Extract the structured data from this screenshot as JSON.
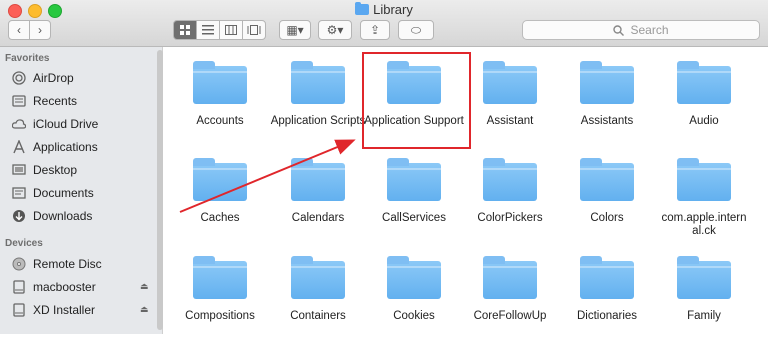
{
  "window": {
    "title": "Library"
  },
  "toolbar": {
    "back_label": "‹",
    "forward_label": "›",
    "arrange_label": "▦▾",
    "action_label": "⚙▾",
    "share_label": "⇪",
    "tag_label": "⬭",
    "search_placeholder": "Search"
  },
  "sidebar": {
    "favorites_heading": "Favorites",
    "devices_heading": "Devices",
    "favorites": [
      {
        "label": "AirDrop",
        "icon": "airdrop-icon"
      },
      {
        "label": "Recents",
        "icon": "recents-icon"
      },
      {
        "label": "iCloud Drive",
        "icon": "cloud-icon"
      },
      {
        "label": "Applications",
        "icon": "applications-icon"
      },
      {
        "label": "Desktop",
        "icon": "desktop-icon"
      },
      {
        "label": "Documents",
        "icon": "documents-icon"
      },
      {
        "label": "Downloads",
        "icon": "downloads-icon"
      }
    ],
    "devices": [
      {
        "label": "Remote Disc",
        "icon": "disc-icon"
      },
      {
        "label": "macbooster",
        "icon": "drive-icon"
      },
      {
        "label": "XD Installer",
        "icon": "drive-icon"
      }
    ]
  },
  "folders": [
    "Accounts",
    "Application Scripts",
    "Application Support",
    "Assistant",
    "Assistants",
    "Audio",
    "Caches",
    "Calendars",
    "CallServices",
    "ColorPickers",
    "Colors",
    "com.apple.internal.ck",
    "Compositions",
    "Containers",
    "Cookies",
    "CoreFollowUp",
    "Dictionaries",
    "Family"
  ],
  "colors": {
    "highlight": "#e0262b",
    "folder": "#6cb6f2"
  }
}
